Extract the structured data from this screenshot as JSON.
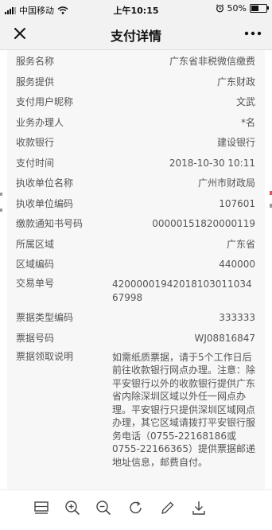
{
  "status_bar": {
    "carrier": "中国移动",
    "time": "上午10:15",
    "battery": "50%",
    "battery_level": 0.5,
    "signal_icon": "signal-bars-icon",
    "wifi_icon": "wifi-icon",
    "alarm_icon": "alarm-clock-icon"
  },
  "nav": {
    "title": "支付详情",
    "close_icon": "close-icon",
    "more_icon": "more-dots-icon"
  },
  "details": [
    {
      "label": "服务名称",
      "value": "广东省非税微信缴费"
    },
    {
      "label": "服务提供",
      "value": "广东财政"
    },
    {
      "label": "支付用户昵称",
      "value": "文武"
    },
    {
      "label": "业务办理人",
      "value": "*名"
    },
    {
      "label": "收款银行",
      "value": "建设银行"
    },
    {
      "label": "支付时间",
      "value": "2018-10-30 10:11"
    },
    {
      "label": "执收单位名称",
      "value": "广州市财政局"
    },
    {
      "label": "执收单位编码",
      "value": "107601"
    },
    {
      "label": "缴款通知书号码",
      "value": "00000151820000119"
    },
    {
      "label": "所属区域",
      "value": "广东省"
    },
    {
      "label": "区域编码",
      "value": "440000"
    },
    {
      "label": "交易单号",
      "value": "4200000194201810301103467998"
    },
    {
      "label": "票据类型编码",
      "value": "333333"
    },
    {
      "label": "票据号码",
      "value": "WJ08816847"
    },
    {
      "label": "票据领取说明",
      "value": "如需纸质票据，请于5个工作日后前往收款银行网点办理。注意：除平安银行以外的收款银行提供广东省内除深圳区域以外任一网点办理。平安银行只提供深圳区域网点办理，其它区域请拨打平安银行服务电话（0755-22168186或0755-22166365）提供票据邮递地址信息，邮费自付。"
    }
  ],
  "toolbar": {
    "icons": [
      "layout-icon",
      "zoom-in-icon",
      "zoom-out-icon",
      "rotate-icon",
      "edit-icon",
      "download-icon"
    ]
  },
  "colors": {
    "bar_bg": "#f2f2f2",
    "sheet_bg": "#f7f7f7",
    "text": "#555555",
    "accent_edge": "#d9534f"
  }
}
